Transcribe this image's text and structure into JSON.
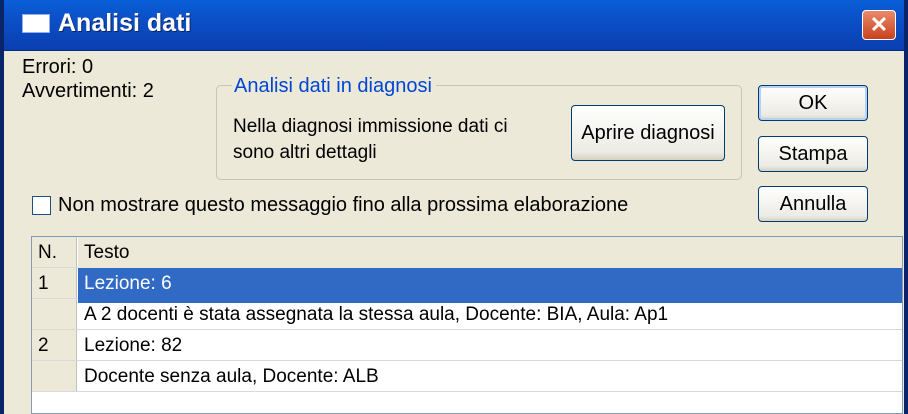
{
  "window": {
    "title": "Analisi dati",
    "close_glyph": "✕"
  },
  "summary": {
    "errors": "Errori: 0",
    "warnings": "Avvertimenti: 2"
  },
  "group": {
    "label": "Analisi dati in diagnosi",
    "text_line1": "Nella diagnosi immissione dati ci",
    "text_line2": "sono altri dettagli",
    "open_button": "Aprire diagnosi"
  },
  "buttons": {
    "ok": "OK",
    "print": "Stampa",
    "cancel": "Annulla"
  },
  "checkbox": {
    "label": "Non mostrare questo messaggio fino alla prossima elaborazione",
    "checked": false
  },
  "table": {
    "headers": {
      "n": "N.",
      "text": "Testo"
    },
    "rows": [
      {
        "n": "1",
        "text": "Lezione: 6",
        "selected": true
      },
      {
        "n": "",
        "text": "A 2 docenti è stata assegnata la stessa aula, Docente: BIA, Aula: Ap1",
        "selected": false
      },
      {
        "n": "2",
        "text": "Lezione: 82",
        "selected": false
      },
      {
        "n": "",
        "text": "Docente senza aula, Docente: ALB",
        "selected": false
      }
    ]
  },
  "colors": {
    "titlebar": "#0a4fc7",
    "selection": "#316ac5",
    "group_label": "#0046d5",
    "close": "#c8411e"
  }
}
